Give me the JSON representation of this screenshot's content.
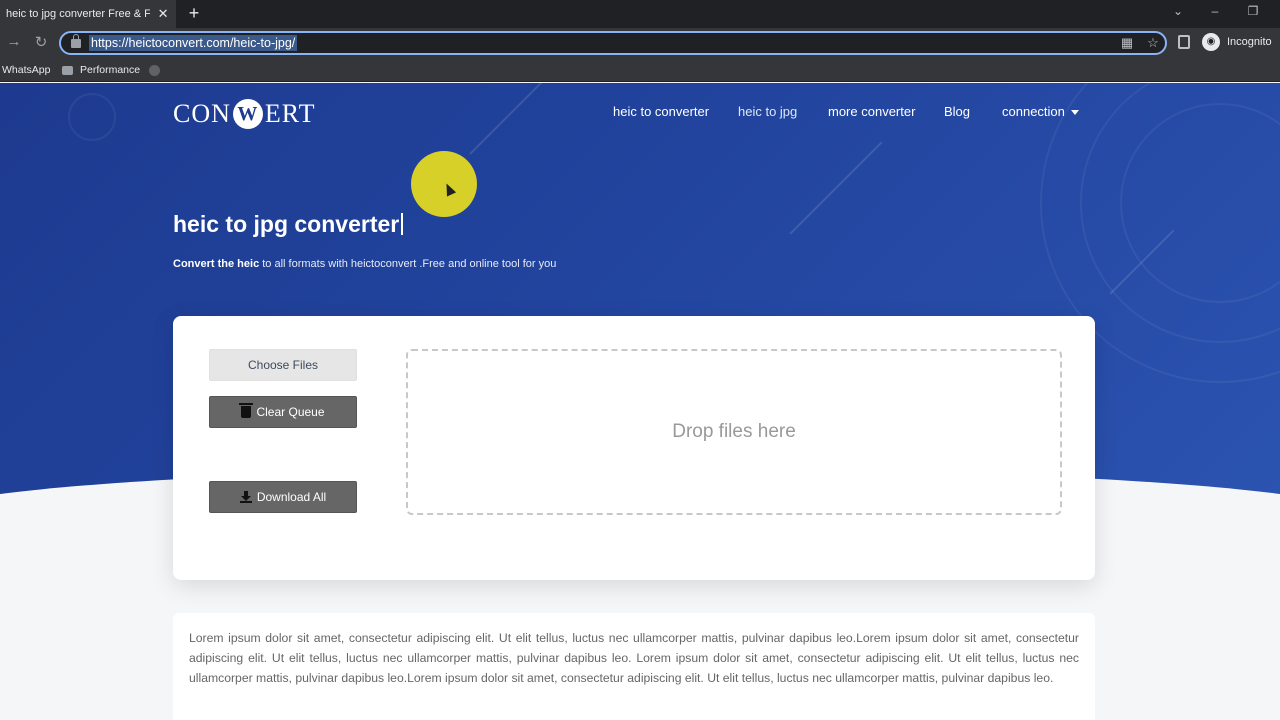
{
  "browser": {
    "tab_title": "heic to jpg converter Free & Fast",
    "tab_close": "✕",
    "new_tab": "+",
    "url": "https://heictoconvert.com/heic-to-jpg/",
    "profile_label": "Incognito",
    "bookmarks": [
      "WhatsApp",
      "Performance"
    ]
  },
  "site": {
    "logo_left": "CON",
    "logo_mark": "W",
    "logo_right": "ERT",
    "nav": [
      "heic to converter",
      "heic to jpg",
      "more converter",
      "Blog",
      "connection"
    ],
    "hero_title": "heic to jpg converter",
    "hero_sub_bold": "Convert the heic",
    "hero_sub_rest": " to all formats  with heictoconvert .Free and online tool for you"
  },
  "uploader": {
    "choose_label": "Choose Files",
    "clear_label": "Clear Queue",
    "download_label": "Download All",
    "drop_label": "Drop files here"
  },
  "body_text": "Lorem ipsum dolor sit amet, consectetur adipiscing elit. Ut elit tellus, luctus nec ullamcorper mattis, pulvinar dapibus leo.Lorem ipsum dolor sit amet, consectetur adipiscing elit. Ut elit tellus, luctus nec ullamcorper mattis, pulvinar dapibus leo. Lorem ipsum dolor sit amet, consectetur adipiscing elit. Ut elit tellus, luctus nec ullamcorper mattis, pulvinar dapibus leo.Lorem ipsum dolor sit amet, consectetur adipiscing elit. Ut elit tellus, luctus nec ullamcorper mattis, pulvinar dapibus leo.",
  "colors": {
    "hero": "#22449e",
    "accent_cursor": "#e6dc1e",
    "button_dark": "#666666"
  }
}
